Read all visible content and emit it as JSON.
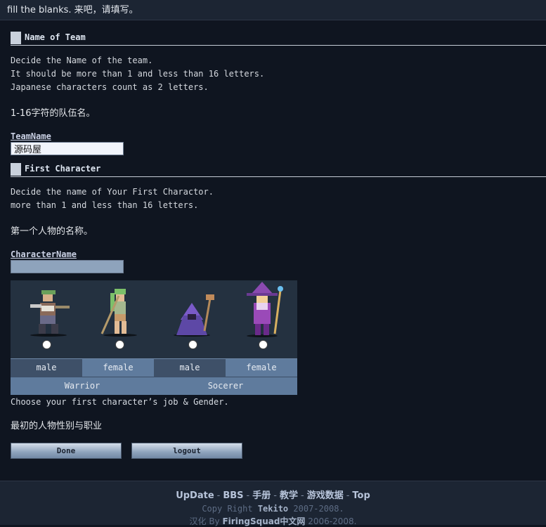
{
  "header": {
    "text": "fill the blanks. 来吧，请填写。"
  },
  "team_section": {
    "title": "Name of Team",
    "desc_lines": [
      "Decide the Name of the team.",
      "It should be more than 1 and less than 16 letters.",
      "Japanese characters count as 2 letters."
    ],
    "zh": "1-16字符的队伍名。",
    "field_label": "TeamName",
    "field_value": "源码屋"
  },
  "char_section": {
    "title": "First Character",
    "desc_lines": [
      "Decide the name of Your First Charactor.",
      "more than 1 and less than 16 letters."
    ],
    "zh": "第一个人物的名称。",
    "field_label": "CharacterName",
    "field_value": ""
  },
  "characters": [
    {
      "gender": "male",
      "job": "Warrior",
      "icon": "warrior-male-sprite"
    },
    {
      "gender": "female",
      "job": "Warrior",
      "icon": "warrior-female-sprite"
    },
    {
      "gender": "male",
      "job": "Socerer",
      "icon": "sorcerer-male-sprite"
    },
    {
      "gender": "female",
      "job": "Socerer",
      "icon": "sorcerer-female-sprite"
    }
  ],
  "jobs": [
    "Warrior",
    "Socerer"
  ],
  "choose_text": "Choose your first character’s job & Gender.",
  "choose_zh": "最初的人物性别与职业",
  "buttons": {
    "done": "Done",
    "logout": "logout"
  },
  "footer": {
    "links": [
      "UpDate",
      "BBS",
      "手册",
      "教学",
      "游戏数据",
      "Top"
    ],
    "copy_prefix": "Copy Right",
    "copy_name": "Tekito",
    "copy_years": "2007-2008.",
    "zh_prefix": "汉化 By",
    "zh_name": "FiringSquad中文网",
    "zh_years": "2006-2008."
  },
  "colors": {
    "background": "#0f1520",
    "accent": "#5f7b9d",
    "header": "#1c2533"
  }
}
